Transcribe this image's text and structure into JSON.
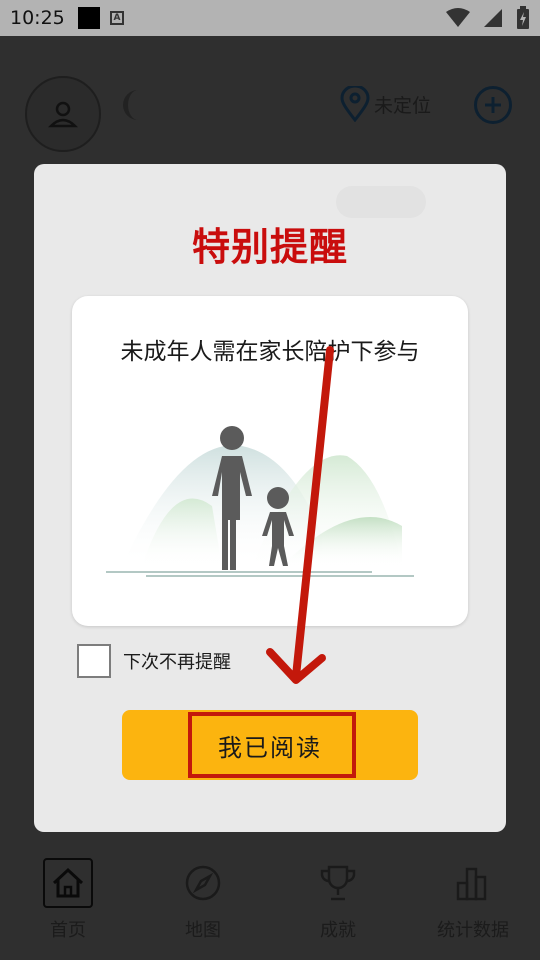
{
  "status_bar": {
    "time": "10:25"
  },
  "header": {
    "location_text": "未定位"
  },
  "dialog": {
    "title": "特别提醒",
    "message": "未成年人需在家长陪护下参与",
    "checkbox_label": "下次不再提醒",
    "confirm_button": "我已阅读"
  },
  "bottom_nav": {
    "items": [
      {
        "label": "首页",
        "icon": "home-icon"
      },
      {
        "label": "地图",
        "icon": "compass-icon"
      },
      {
        "label": "成就",
        "icon": "trophy-icon"
      },
      {
        "label": "统计数据",
        "icon": "bar-chart-icon"
      }
    ]
  },
  "colors": {
    "title_red": "#c90d0d",
    "button_yellow": "#fcb40f",
    "annotation_red": "#c3180b"
  }
}
